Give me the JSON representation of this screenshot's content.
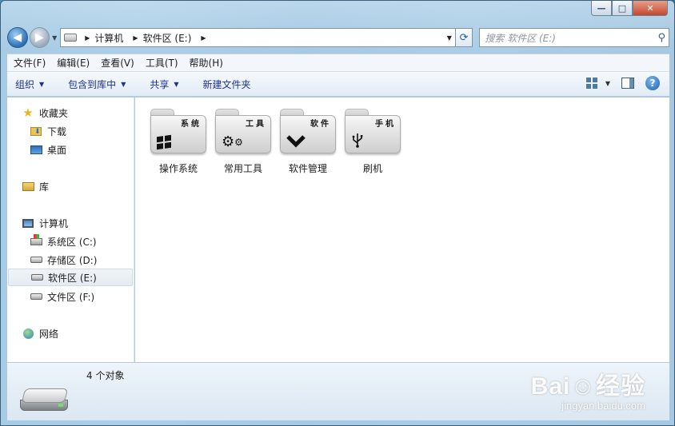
{
  "window": {
    "minimize_glyph": "—",
    "maximize_glyph": "□",
    "close_glyph": "✕"
  },
  "nav": {
    "back_glyph": "◀",
    "forward_glyph": "▶",
    "breadcrumb": [
      "计算机",
      "软件区 (E:)"
    ],
    "search_placeholder": "搜索 软件区 (E:)"
  },
  "menubar": [
    "文件(F)",
    "编辑(E)",
    "查看(V)",
    "工具(T)",
    "帮助(H)"
  ],
  "commands": {
    "organize": "组织",
    "include_in_library": "包含到库中",
    "share": "共享",
    "new_folder": "新建文件夹"
  },
  "sidebar": {
    "favorites": {
      "label": "收藏夹",
      "items": [
        "下载",
        "桌面"
      ]
    },
    "libraries": {
      "label": "库"
    },
    "computer": {
      "label": "计算机",
      "drives": [
        "系统区 (C:)",
        "存储区 (D:)",
        "软件区 (E:)",
        "文件区 (F:)"
      ],
      "selected": "软件区 (E:)"
    },
    "network": {
      "label": "网络"
    }
  },
  "folders": [
    {
      "name": "操作系统",
      "tag": "系统",
      "icon": "windows-logo-icon"
    },
    {
      "name": "常用工具",
      "tag": "工具",
      "icon": "gears-icon"
    },
    {
      "name": "软件管理",
      "tag": "软件",
      "icon": "checkmark-icon"
    },
    {
      "name": "刷机",
      "tag": "手机",
      "icon": "usb-icon"
    }
  ],
  "status": {
    "item_count": "4 个对象"
  },
  "watermark": {
    "brand": "Bai☺经验",
    "url": "jingyan.baidu.com"
  }
}
